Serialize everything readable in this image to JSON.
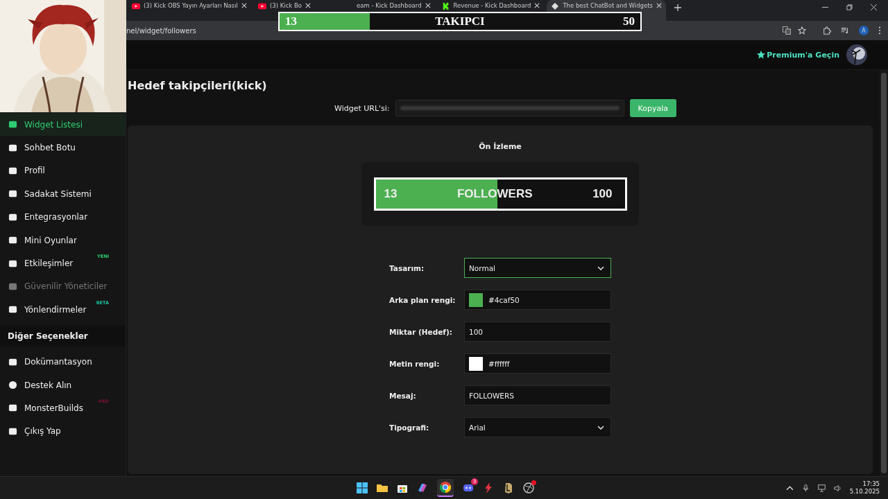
{
  "browser": {
    "tabs": [
      {
        "title": "(3) Kick OBS Yayın Ayarları Nasıl",
        "selected": false
      },
      {
        "title": "(3) Kick Bo",
        "selected": false
      },
      {
        "title": "eam - Kick Dashboard",
        "selected": false
      },
      {
        "title": "Revenue - Kick Dashboard",
        "selected": false
      },
      {
        "title": "The best ChatBot and Widgets",
        "selected": true
      }
    ],
    "address": "nel/widget/followers",
    "profile_initial": "A"
  },
  "stream_overlay": {
    "current": "13",
    "message": "TAKIPCI",
    "goal": "50",
    "level": 0.25
  },
  "header": {
    "premium_link": "Premium'a Geçin"
  },
  "sidebar": {
    "items": [
      {
        "label": "Widget Listesi",
        "selected": true,
        "disabled": false
      },
      {
        "label": "Sohbet Botu",
        "selected": false,
        "disabled": false
      },
      {
        "label": "Profil",
        "selected": false,
        "disabled": false
      },
      {
        "label": "Sadakat Sistemi",
        "selected": false,
        "disabled": false
      },
      {
        "label": "Entegrasyonlar",
        "selected": false,
        "disabled": false
      },
      {
        "label": "Mini Oyunlar",
        "selected": false,
        "disabled": false
      },
      {
        "label": "Etkileşimler",
        "selected": false,
        "disabled": false,
        "badge": "YENI",
        "color": "#2ecc71"
      },
      {
        "label": "Güvenilir Yöneticiler",
        "selected": false,
        "disabled": true
      },
      {
        "label": "Yönlendirmeler",
        "selected": false,
        "disabled": false,
        "badge": "BETA",
        "color": "#1abc9c"
      }
    ],
    "section_title": "Diğer Seçenekler",
    "other_items": [
      {
        "label": "Dokümantasyon",
        "selected": false,
        "disabled": false
      },
      {
        "label": "Destek Alın",
        "selected": false,
        "disabled": false
      },
      {
        "label": "MonsterBuilds",
        "selected": false,
        "disabled": false,
        "badge": "#AD",
        "color": "#7a1030"
      },
      {
        "label": "Çıkış Yap",
        "selected": false,
        "disabled": false
      }
    ]
  },
  "page": {
    "title": "Hedef takipçileri(kick)",
    "url_label": "Widget URL'si:",
    "copy_button": "Kopyala",
    "preview_title": "Ön İzleme",
    "preview_widget": {
      "current": "13",
      "message": "FOLLOWERS",
      "goal": "100",
      "level": 0.49
    },
    "form": [
      {
        "label": "Tasarım:",
        "kind": "select",
        "value": "Normal",
        "focused": true
      },
      {
        "label": "Arka plan rengi:",
        "kind": "color",
        "value": "#4caf50",
        "focused": false
      },
      {
        "label": "Miktar (Hedef):",
        "kind": "text",
        "value": "100",
        "focused": false
      },
      {
        "label": "Metin rengi:",
        "kind": "color",
        "value": "#ffffff",
        "focused": false
      },
      {
        "label": "Mesaj:",
        "kind": "text",
        "value": "FOLLOWERS",
        "focused": false
      },
      {
        "label": "Tipografi:",
        "kind": "select",
        "value": "Arial",
        "focused": false
      }
    ]
  },
  "taskbar": {
    "chat_badge": "3",
    "time": "17:35",
    "date": "5.10.2025"
  }
}
